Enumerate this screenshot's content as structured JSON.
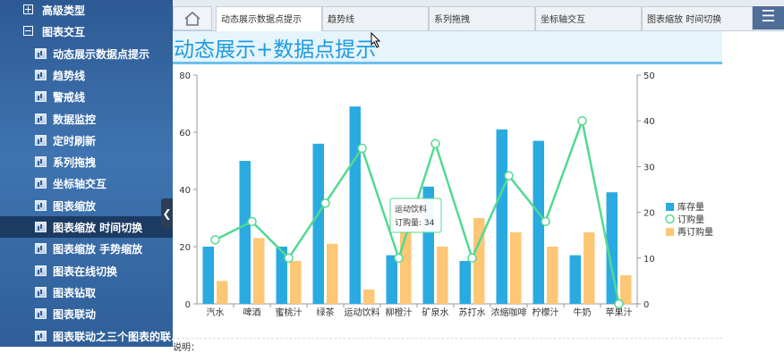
{
  "sidebar": {
    "items": [
      {
        "label": "高级类型",
        "type": "group",
        "icon": "expand-icon",
        "active": false
      },
      {
        "label": "图表交互",
        "type": "group",
        "icon": "collapse-icon",
        "active": false
      },
      {
        "label": "动态展示数据点提示",
        "type": "sub",
        "icon": "chart-icon",
        "active": false
      },
      {
        "label": "趋势线",
        "type": "sub",
        "icon": "chart-icon",
        "active": false
      },
      {
        "label": "警戒线",
        "type": "sub",
        "icon": "chart-icon",
        "active": false
      },
      {
        "label": "数据监控",
        "type": "sub",
        "icon": "chart-icon",
        "active": false
      },
      {
        "label": "定时刷新",
        "type": "sub",
        "icon": "chart-icon",
        "active": false
      },
      {
        "label": "系列拖拽",
        "type": "sub",
        "icon": "chart-icon",
        "active": false
      },
      {
        "label": "坐标轴交互",
        "type": "sub",
        "icon": "chart-icon",
        "active": false
      },
      {
        "label": "图表缩放",
        "type": "sub",
        "icon": "chart-icon",
        "active": false
      },
      {
        "label": "图表缩放 时间切换",
        "type": "sub",
        "icon": "chart-icon",
        "active": true
      },
      {
        "label": "图表缩放 手势缩放",
        "type": "sub",
        "icon": "chart-icon",
        "active": false
      },
      {
        "label": "图表在线切换",
        "type": "sub",
        "icon": "chart-icon",
        "active": false
      },
      {
        "label": "图表钻取",
        "type": "sub",
        "icon": "chart-icon",
        "active": false
      },
      {
        "label": "图表联动",
        "type": "sub",
        "icon": "chart-icon",
        "active": false
      },
      {
        "label": "图表联动之三个图表的联...",
        "type": "sub",
        "icon": "chart-icon",
        "active": false
      }
    ],
    "collapse_glyph": "❮"
  },
  "tabs": {
    "home_icon": "home-icon",
    "items": [
      {
        "label": "动态展示数据点提示",
        "active": true
      },
      {
        "label": "趋势线",
        "active": false
      },
      {
        "label": "系列拖拽",
        "active": false
      },
      {
        "label": "坐标轴交互",
        "active": false
      },
      {
        "label": "图表缩放 时间切换",
        "active": false
      }
    ],
    "menu_glyph": "☰"
  },
  "content": {
    "title": "动态展示+数据点提示",
    "notes_label": "说明："
  },
  "tooltip": {
    "series": "运动饮料",
    "text": "订购量: 34"
  },
  "colors": {
    "stock": "#29aae1",
    "order": "#52d991",
    "reorder": "#fdc776"
  },
  "chart_data": {
    "type": "bar",
    "categories": [
      "汽水",
      "啤酒",
      "蜜桃汁",
      "绿茶",
      "运动饮料",
      "柳橙汁",
      "矿泉水",
      "苏打水",
      "浓缩咖啡",
      "柠檬汁",
      "牛奶",
      "苹果汁"
    ],
    "series": [
      {
        "name": "库存量",
        "type": "bar",
        "axis": "left",
        "values": [
          20,
          50,
          20,
          56,
          69,
          17,
          41,
          15,
          61,
          57,
          17,
          39
        ]
      },
      {
        "name": "订购量",
        "type": "line",
        "axis": "right",
        "values": [
          14,
          18,
          10,
          22,
          34,
          10,
          35,
          10,
          28,
          18,
          40,
          0
        ]
      },
      {
        "name": "再订购量",
        "type": "bar",
        "axis": "left",
        "values": [
          8,
          23,
          15,
          21,
          5,
          25,
          20,
          30,
          25,
          20,
          25,
          10
        ]
      }
    ],
    "left_axis": {
      "ylim": [
        0,
        80
      ],
      "ticks": [
        0,
        20,
        40,
        60,
        80
      ]
    },
    "right_axis": {
      "ylim": [
        0,
        50
      ],
      "ticks": [
        0,
        10,
        20,
        30,
        40,
        50
      ]
    },
    "legend": "right",
    "grid": false
  }
}
